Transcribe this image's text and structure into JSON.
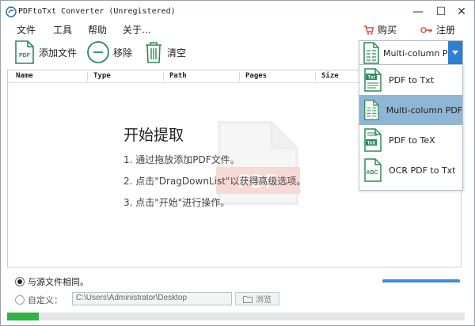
{
  "window": {
    "title": "PDFtoTxt Converter (Unregistered)",
    "min_symbol": "—",
    "max_symbol": "☐",
    "close_symbol": "✕"
  },
  "menu": [
    "文件",
    "工具",
    "帮助",
    "关于..."
  ],
  "header_links": {
    "buy": "购买",
    "register": "注册"
  },
  "toolbar": {
    "add_label": "添加文件",
    "remove_label": "移除",
    "clear_label": "清空"
  },
  "mode_select": {
    "value": "Multi-column PD"
  },
  "table": {
    "columns": [
      "Name",
      "Type",
      "Path",
      "Pages",
      "Size"
    ]
  },
  "empty_state": {
    "title": "开始提取",
    "steps": [
      "1. 通过拖放添加PDF文件。",
      "2. 点击\"DragDownList\"以获得高级选项。",
      "3. 点击\"开始\"进行操作。"
    ],
    "watermark_text": "PDF"
  },
  "dropdown": {
    "items": [
      {
        "label": "PDF to Txt",
        "badge": "Txt",
        "selected": false
      },
      {
        "label": "Multi-column PDF",
        "badge": "",
        "selected": true
      },
      {
        "label": "PDF to TeX",
        "badge": "TeX",
        "selected": false
      },
      {
        "label": "OCR PDF to Txt",
        "badge": "ABC",
        "selected": false
      }
    ]
  },
  "output": {
    "same_as_source_label": "与源文件相同。",
    "custom_label": "自定义：",
    "custom_path": "C:\\Users\\Administrator\\Desktop",
    "browse_label": "浏览",
    "same_as_source_selected": true
  },
  "progress": {
    "fraction": 0.07
  },
  "colors": {
    "accent": "#2f7fd3",
    "selected_item": "#90b6d6",
    "progress": "#2fb343",
    "icon_green": "#2e8b57",
    "register_red": "#e0463a"
  }
}
